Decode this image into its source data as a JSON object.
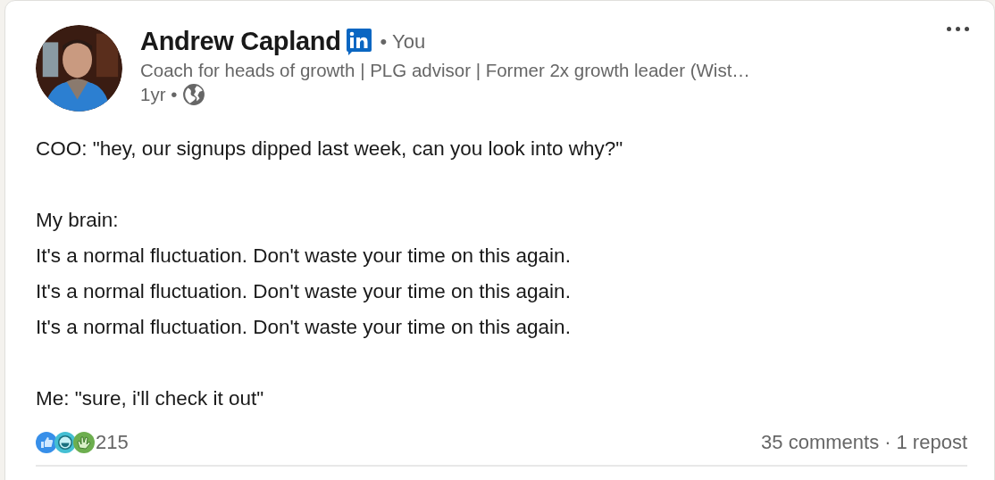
{
  "post": {
    "author": {
      "name": "Andrew Capland",
      "relation": "• You",
      "headline": "Coach for heads of growth | PLG advisor | Former 2x growth leader (Wist…",
      "time": "1yr •"
    },
    "body": [
      [
        "COO: \"hey, our signups dipped last week, can you look into why?\""
      ],
      [
        "My brain:",
        "It's a normal fluctuation. Don't waste your time on this again.",
        "It's a normal fluctuation. Don't waste your time on this again.",
        "It's a normal fluctuation. Don't waste your time on this again."
      ],
      [
        "Me: \"sure, i'll check it out\""
      ]
    ],
    "reactions": {
      "icons": [
        {
          "kind": "like"
        },
        {
          "kind": "laugh"
        },
        {
          "kind": "clap"
        }
      ],
      "count": "215"
    },
    "comments": "35 comments",
    "separator": "·",
    "reposts": "1 repost"
  }
}
